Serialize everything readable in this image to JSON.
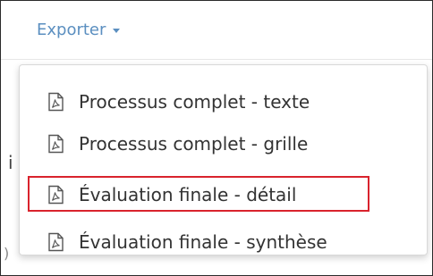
{
  "export_menu": {
    "trigger_label": "Exporter",
    "items": [
      {
        "label": "Processus complet - texte",
        "icon": "pdf-icon"
      },
      {
        "label": "Processus complet - grille",
        "icon": "pdf-icon"
      },
      {
        "label": "Évaluation finale - détail",
        "icon": "pdf-icon",
        "highlighted": true
      },
      {
        "label": "Évaluation finale - synthèse",
        "icon": "pdf-icon"
      }
    ]
  },
  "background_fragments": {
    "left_char_a": "i",
    "left_char_b": ")"
  },
  "colors": {
    "trigger": "#5b8fc0",
    "highlight": "#d9232d",
    "menu_text": "#333333"
  }
}
